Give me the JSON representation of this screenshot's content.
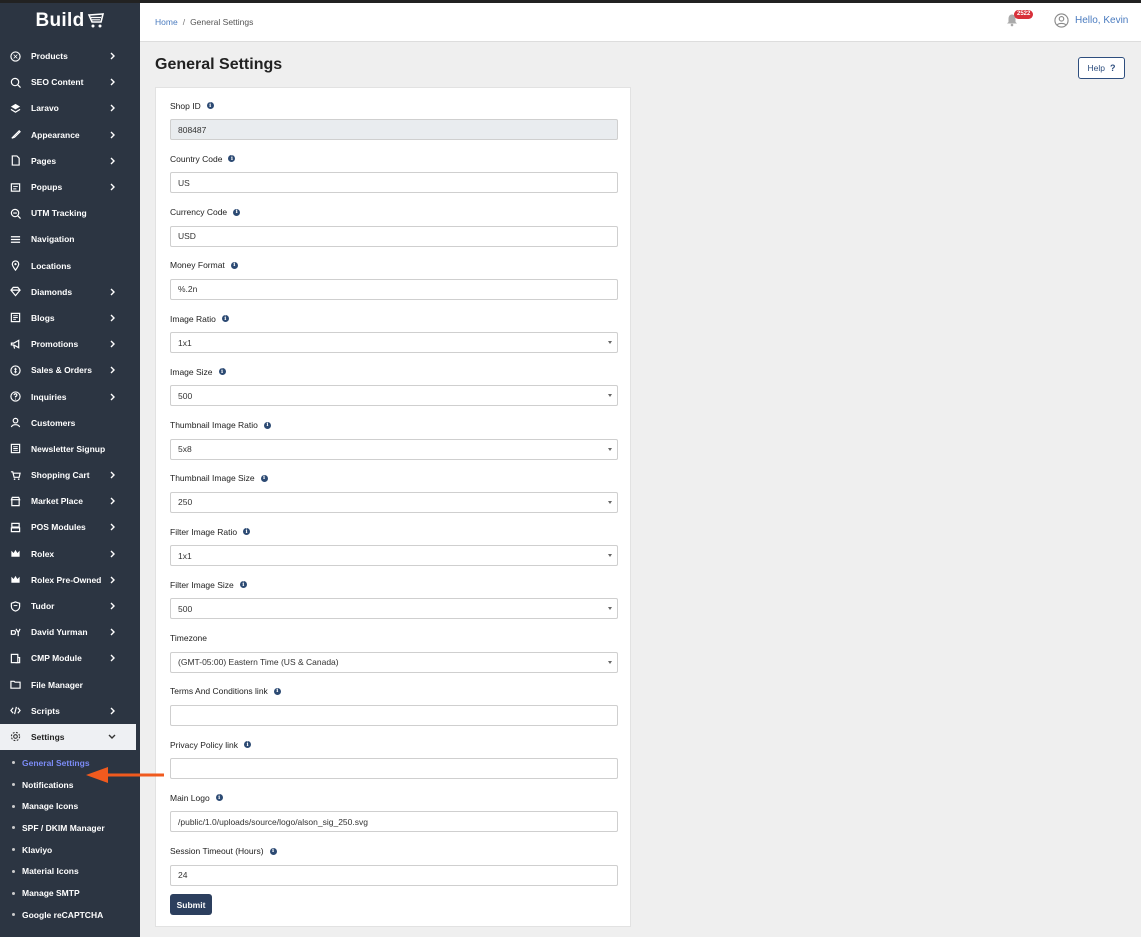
{
  "brand": {
    "logo_text": "Build"
  },
  "breadcrumb": {
    "home": "Home",
    "separator": "/",
    "current": "General Settings"
  },
  "header": {
    "notification_count": "2522",
    "user_greeting": "Hello, Kevin"
  },
  "sidebar": {
    "items": [
      {
        "label": "Products",
        "icon": "tag-icon",
        "has_children": true
      },
      {
        "label": "SEO Content",
        "icon": "seo-search-icon",
        "has_children": true
      },
      {
        "label": "Laravo",
        "icon": "layers-icon",
        "has_children": true
      },
      {
        "label": "Appearance",
        "icon": "brush-icon",
        "has_children": true
      },
      {
        "label": "Pages",
        "icon": "page-icon",
        "has_children": true
      },
      {
        "label": "Popups",
        "icon": "popup-icon",
        "has_children": true
      },
      {
        "label": "UTM Tracking",
        "icon": "tracking-icon",
        "has_children": false
      },
      {
        "label": "Navigation",
        "icon": "menu-icon",
        "has_children": false
      },
      {
        "label": "Locations",
        "icon": "location-pin-icon",
        "has_children": false
      },
      {
        "label": "Diamonds",
        "icon": "diamond-icon",
        "has_children": true
      },
      {
        "label": "Blogs",
        "icon": "blog-icon",
        "has_children": true
      },
      {
        "label": "Promotions",
        "icon": "megaphone-icon",
        "has_children": true
      },
      {
        "label": "Sales & Orders",
        "icon": "sales-icon",
        "has_children": true
      },
      {
        "label": "Inquiries",
        "icon": "question-icon",
        "has_children": true
      },
      {
        "label": "Customers",
        "icon": "person-icon",
        "has_children": false
      },
      {
        "label": "Newsletter Signup",
        "icon": "newsletter-icon",
        "has_children": false
      },
      {
        "label": "Shopping Cart",
        "icon": "cart-icon",
        "has_children": true
      },
      {
        "label": "Market Place",
        "icon": "store-icon",
        "has_children": true
      },
      {
        "label": "POS Modules",
        "icon": "pos-icon",
        "has_children": true
      },
      {
        "label": "Rolex",
        "icon": "crown-icon",
        "has_children": true
      },
      {
        "label": "Rolex Pre-Owned",
        "icon": "crown-icon",
        "has_children": true
      },
      {
        "label": "Tudor",
        "icon": "shield-icon",
        "has_children": true
      },
      {
        "label": "David Yurman",
        "icon": "dy-icon",
        "has_children": true
      },
      {
        "label": "CMP Module",
        "icon": "cmp-icon",
        "has_children": true
      },
      {
        "label": "File Manager",
        "icon": "folder-icon",
        "has_children": false
      },
      {
        "label": "Scripts",
        "icon": "code-icon",
        "has_children": true
      }
    ],
    "settings": {
      "label": "Settings",
      "icon": "gear-icon",
      "expanded": true,
      "children": [
        "General Settings",
        "Notifications",
        "Manage Icons",
        "SPF / DKIM Manager",
        "Klaviyo",
        "Material Icons",
        "Manage SMTP",
        "Google reCAPTCHA"
      ],
      "current": "General Settings"
    }
  },
  "page": {
    "title": "General Settings",
    "help_label": "Help",
    "help_glyph": "?"
  },
  "form": {
    "fields": [
      {
        "label": "Shop ID",
        "value": "808487",
        "type": "text",
        "disabled": true,
        "info": true
      },
      {
        "label": "Country Code",
        "value": "US",
        "type": "text",
        "info": true
      },
      {
        "label": "Currency Code",
        "value": "USD",
        "type": "text",
        "info": true
      },
      {
        "label": "Money Format",
        "value": "%.2n",
        "type": "text",
        "info": true
      },
      {
        "label": "Image Ratio",
        "value": "1x1",
        "type": "select",
        "info": true
      },
      {
        "label": "Image Size",
        "value": "500",
        "type": "select",
        "info": true
      },
      {
        "label": "Thumbnail Image Ratio",
        "value": "5x8",
        "type": "select",
        "info": true
      },
      {
        "label": "Thumbnail Image Size",
        "value": "250",
        "type": "select",
        "info": true
      },
      {
        "label": "Filter Image Ratio",
        "value": "1x1",
        "type": "select",
        "info": true
      },
      {
        "label": "Filter Image Size",
        "value": "500",
        "type": "select",
        "info": true
      },
      {
        "label": "Timezone",
        "value": "(GMT-05:00) Eastern Time (US & Canada)",
        "type": "select",
        "info": false
      },
      {
        "label": "Terms And Conditions link",
        "value": "",
        "type": "text",
        "info": true
      },
      {
        "label": "Privacy Policy link",
        "value": "",
        "type": "text",
        "info": true
      },
      {
        "label": "Main Logo",
        "value": "/public/1.0/uploads/source/logo/alson_sig_250.svg",
        "type": "text",
        "info": true
      },
      {
        "label": "Session Timeout (Hours)",
        "value": "24",
        "type": "text",
        "info": true
      }
    ],
    "submit_label": "Submit",
    "info_glyph": "i"
  },
  "colors": {
    "sidebar_bg": "#2c3542",
    "accent_link": "#4a7bbf",
    "submit_bg": "#2c3f5e",
    "annotation_arrow": "#f05a1e",
    "badge": "#d8303a"
  }
}
